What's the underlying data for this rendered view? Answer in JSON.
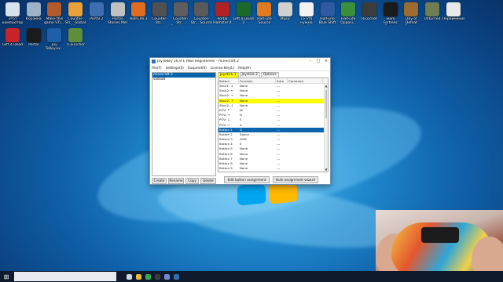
{
  "desktop": {
    "icons_row1": [
      "Этот компьютер",
      "Корзина",
      "Make this game VTL...",
      "Counter-Str... Global Offe...",
      "Portal 2",
      "Portal Stories Mel",
      "Half-Life 2",
      "Counter-Str...",
      "Counter-Str... Condition...",
      "Counter-Str... Source",
      "Portal Hamster 4",
      "Left 4 Dead 2",
      "Half-Life Source",
      "Music",
      "То что нужно Чтобы вставать",
      "Half-Life Blue Shift",
      "Half-Life Opposi...",
      "Ricochet",
      "Team Fortress Classic",
      "Day of Defeat Source",
      "Unturned",
      "Переименов..."
    ],
    "icons_row2": [
      "Left 4 Dead",
      "Portal",
      "Joy ToKey.ex...",
      "TLauncher"
    ]
  },
  "window": {
    "title": "JoyToKey v6.9.1 (Not Registered) - minecraft 2",
    "menu": [
      "File(F)",
      "Settings(S)",
      "Suspend(S)",
      "License Key(L)",
      "Help(H)"
    ],
    "profiles": [
      "minecraft 2",
      "sadsad"
    ],
    "profile_buttons": [
      "Create",
      "Rename",
      "Copy",
      "Delete"
    ],
    "tabs": [
      "Joystick 1",
      "Joystick 2",
      "Options"
    ],
    "columns": [
      "Button",
      "Function",
      "Auto",
      "Comment"
    ],
    "rows": [
      {
        "button": "Stick1: ↓",
        "function": "None",
        "auto": "---",
        "state": ""
      },
      {
        "button": "Stick2: ←",
        "function": "None",
        "auto": "---",
        "state": ""
      },
      {
        "button": "Stick2: →",
        "function": "None",
        "auto": "---",
        "state": ""
      },
      {
        "button": "Stick2: ↑",
        "function": "None",
        "auto": "---",
        "state": "hl"
      },
      {
        "button": "Stick2: ↓",
        "function": "None",
        "auto": "---",
        "state": ""
      },
      {
        "button": "POV: ↑",
        "function": "W",
        "auto": "---",
        "state": ""
      },
      {
        "button": "POV: →",
        "function": "D",
        "auto": "---",
        "state": ""
      },
      {
        "button": "POV: ↓",
        "function": "S",
        "auto": "---",
        "state": ""
      },
      {
        "button": "POV: ←",
        "function": "A",
        "auto": "---",
        "state": ""
      },
      {
        "button": "Button 1",
        "function": "Q",
        "auto": "---",
        "state": "sel"
      },
      {
        "button": "Button 2",
        "function": "Space",
        "auto": "---",
        "state": ""
      },
      {
        "button": "Button 3",
        "function": "Shift",
        "auto": "---",
        "state": ""
      },
      {
        "button": "Button 4",
        "function": "E",
        "auto": "---",
        "state": ""
      },
      {
        "button": "Button 5",
        "function": "None",
        "auto": "---",
        "state": ""
      },
      {
        "button": "Button 6",
        "function": "None",
        "auto": "---",
        "state": ""
      },
      {
        "button": "Button 7",
        "function": "None",
        "auto": "---",
        "state": ""
      },
      {
        "button": "Button 8",
        "function": "None",
        "auto": "---",
        "state": ""
      },
      {
        "button": "Button 9",
        "function": "None",
        "auto": "---",
        "state": ""
      }
    ],
    "assign_buttons": [
      "Edit button assignment",
      "Bulk assignment wizard"
    ]
  },
  "taskbar": {
    "search_placeholder": "",
    "apps": [
      "taskview-icon",
      "explorer-icon",
      "chrome-icon",
      "obs-icon",
      "discord-icon",
      "joytokey-icon"
    ]
  },
  "colors": {
    "highlight": "#ffff00",
    "selection": "#0a64ad",
    "taskbar": "#0f1a2c"
  }
}
